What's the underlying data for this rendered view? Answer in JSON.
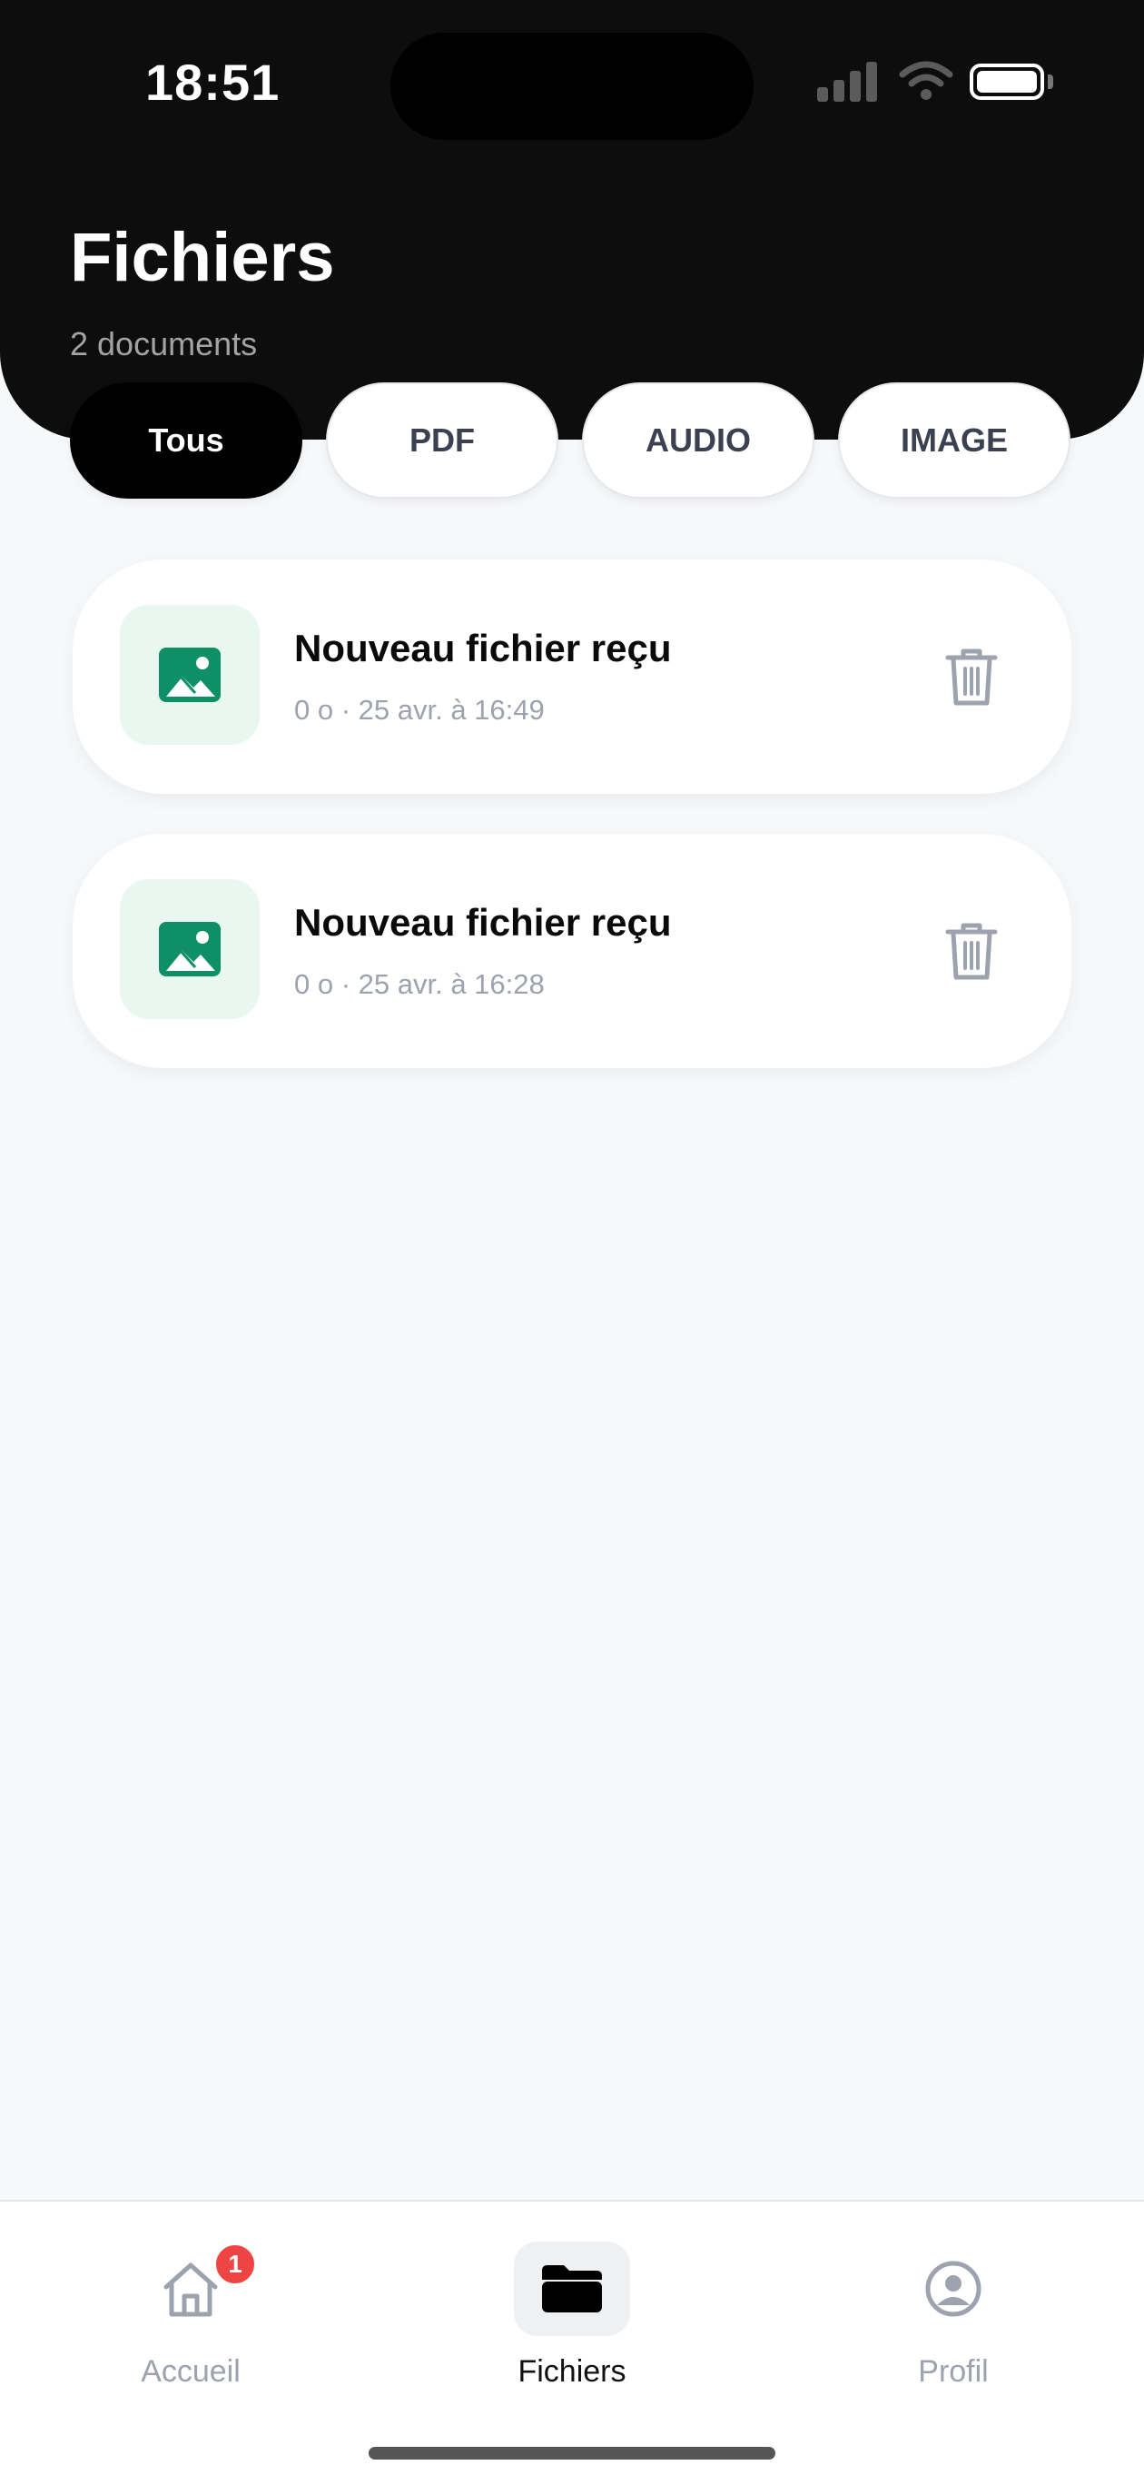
{
  "status_bar": {
    "time": "18:51"
  },
  "header": {
    "title": "Fichiers",
    "subtitle": "2 documents"
  },
  "filters": [
    {
      "label": "Tous",
      "active": true
    },
    {
      "label": "PDF",
      "active": false
    },
    {
      "label": "AUDIO",
      "active": false
    },
    {
      "label": "IMAGE",
      "active": false
    }
  ],
  "files": [
    {
      "name": "Nouveau fichier reçu",
      "meta": "0 o · 25 avr. à 16:49",
      "icon": "image-icon"
    },
    {
      "name": "Nouveau fichier reçu",
      "meta": "0 o · 25 avr. à 16:28",
      "icon": "image-icon"
    }
  ],
  "bottom_nav": {
    "items": [
      {
        "label": "Accueil",
        "icon": "home-icon",
        "badge": "1",
        "active": false
      },
      {
        "label": "Fichiers",
        "icon": "folder-icon",
        "active": true
      },
      {
        "label": "Profil",
        "icon": "user-circle-icon",
        "active": false
      }
    ]
  },
  "colors": {
    "header_bg": "#0d0d0d",
    "accent_green": "#0f8f66",
    "thumb_bg": "#e8f8f1",
    "badge_red": "#ef4444",
    "muted_text": "#9ca3af"
  }
}
